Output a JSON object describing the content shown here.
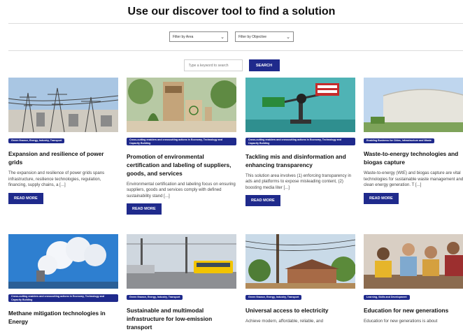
{
  "header": {
    "title": "Use our discover tool to find a solution"
  },
  "filters": {
    "area": {
      "value": "Filter by Area"
    },
    "objective": {
      "value": "Filter by Objective"
    },
    "search_placeholder": "Type a keyword to search",
    "search_label": "SEARCH"
  },
  "accent_color": "#1f2a8c",
  "cards": [
    {
      "tag": "Green finance, Energy, Industry, Transport",
      "title": "Expansion and resilience of power grids",
      "body": "The expansion and resilience of power grids spans infrastructure, resilience technologies, regulation, financing, supply chains, a [...]",
      "read_more": "READ MORE"
    },
    {
      "tag": "Cross-cutting enablers and crosscutting actions in Economy, Technology and Capacity Building",
      "title": "Promotion of environmental certification and labeling of suppliers, goods, and services",
      "body": "Environmental certification and labeling focus on ensuring suppliers, goods and services comply with defined sustainability stand [...]",
      "read_more": "READ MORE"
    },
    {
      "tag": "Cross-cutting enablers and crosscutting actions in Economy, Technology and Capacity Building",
      "title": "Tackling mis and disinformation and enhancing transparency",
      "body": "This solution area involves (1) enforcing transparency in ads and platforms to expose misleading content, (2) boosting media liter [...]",
      "read_more": "READ MORE"
    },
    {
      "tag": "Enabling Business for Cities, Infrastructure and Waste",
      "title": "Waste-to-energy technologies and biogas capture",
      "body": "Waste-to-energy (WtE) and biogas capture are vital technologies for sustainable waste management and clean energy generation. T [...]",
      "read_more": "READ MORE"
    },
    {
      "tag": "Cross-cutting enablers and crosscutting actions in Economy, Technology and Capacity Building",
      "title": "Methane mitigation technologies in Energy",
      "body": "",
      "read_more": ""
    },
    {
      "tag": "Green finance, Energy, Industry, Transport",
      "title": "Sustainable and multimodal infrastructure for low-emission transport",
      "body": "",
      "read_more": ""
    },
    {
      "tag": "Green finance, Energy, Industry, Transport",
      "title": "Universal access to electricity",
      "body": "Achieve modern, affordable, reliable, and",
      "read_more": ""
    },
    {
      "tag": "Learning, Skills and Development",
      "title": "Education for new generations",
      "body": "Education for new generations is about",
      "read_more": ""
    }
  ]
}
